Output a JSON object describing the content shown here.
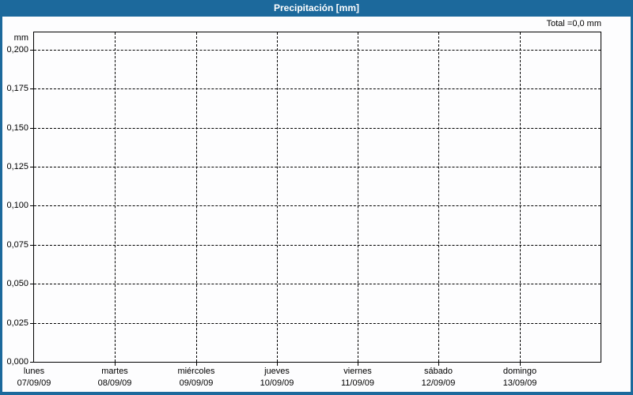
{
  "titlebar": {
    "text": "Precipitación [mm]"
  },
  "summary": {
    "total": "Total =0,0 mm"
  },
  "chart_data": {
    "type": "bar",
    "title": "Precipitación [mm]",
    "ylabel": "mm",
    "xlabel": "",
    "ylim": [
      0,
      0.211
    ],
    "grid": "dashed",
    "legend_position": "none",
    "total_label": "Total =0,0 mm",
    "decimal_separator": ",",
    "y_ticks": [
      {
        "value": 0.2,
        "label": "0,200"
      },
      {
        "value": 0.175,
        "label": "0,175"
      },
      {
        "value": 0.15,
        "label": "0,150"
      },
      {
        "value": 0.125,
        "label": "0,125"
      },
      {
        "value": 0.1,
        "label": "0,100"
      },
      {
        "value": 0.075,
        "label": "0,075"
      },
      {
        "value": 0.05,
        "label": "0,050"
      },
      {
        "value": 0.025,
        "label": "0,025"
      },
      {
        "value": 0.0,
        "label": "0,000"
      }
    ],
    "categories": [
      {
        "day": "lunes",
        "date": "07/09/09"
      },
      {
        "day": "martes",
        "date": "08/09/09"
      },
      {
        "day": "miércoles",
        "date": "09/09/09"
      },
      {
        "day": "jueves",
        "date": "10/09/09"
      },
      {
        "day": "viernes",
        "date": "11/09/09"
      },
      {
        "day": "sábado",
        "date": "12/09/09"
      },
      {
        "day": "domingo",
        "date": "13/09/09"
      }
    ],
    "series": [
      {
        "name": "Precipitación",
        "unit": "mm",
        "values": [
          0,
          0,
          0,
          0,
          0,
          0,
          0
        ]
      }
    ]
  },
  "colors": {
    "titlebar_bg": "#1c699c",
    "titlebar_text": "#ffffff",
    "frame_border": "#1c699c",
    "plot_border": "#000000",
    "grid": "#000000",
    "background": "#fdfdfe",
    "text": "#000000",
    "bar": "#1c699c"
  }
}
